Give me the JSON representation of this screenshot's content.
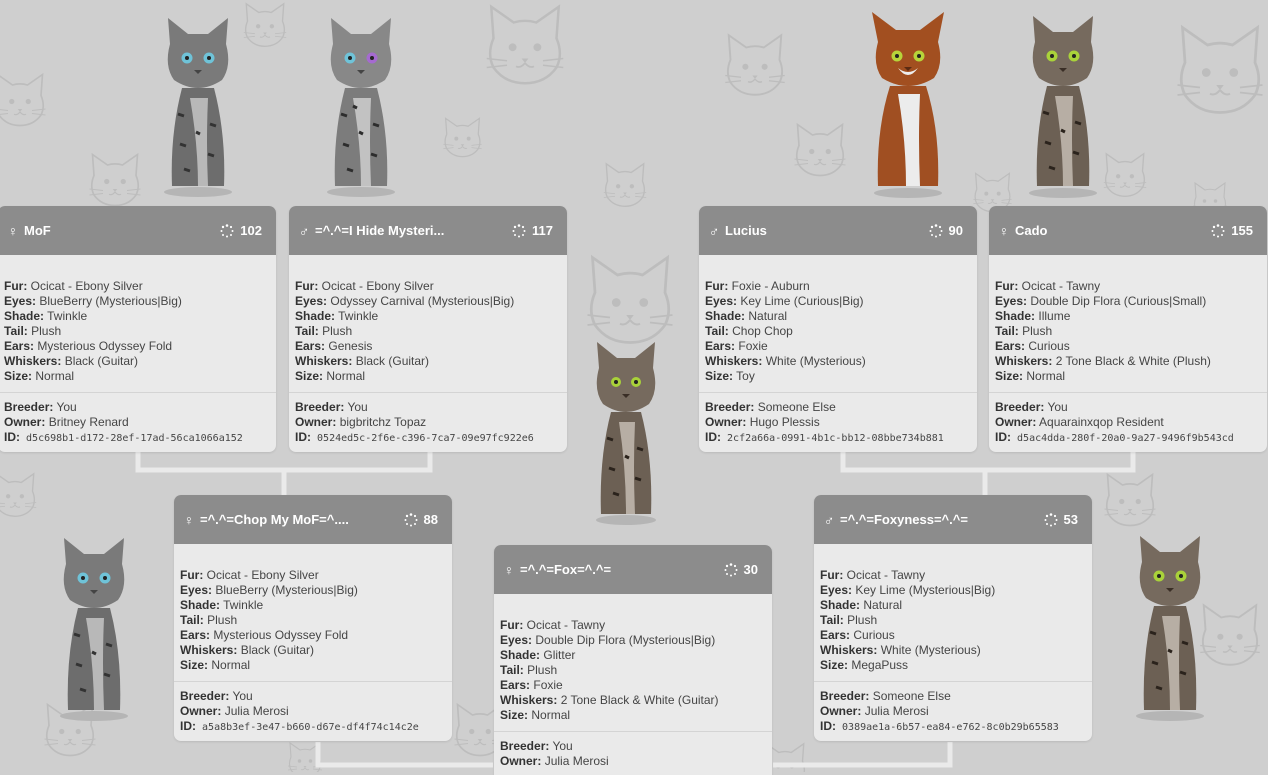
{
  "labels": {
    "fur": "Fur:",
    "eyes": "Eyes:",
    "shade": "Shade:",
    "tail": "Tail:",
    "ears": "Ears:",
    "whiskers": "Whiskers:",
    "size": "Size:",
    "breeder": "Breeder:",
    "owner": "Owner:",
    "id": "ID:"
  },
  "symbols": {
    "female": "♀",
    "male": "♂"
  },
  "colors": {
    "header": "#8c8c8c",
    "card_body": "#eaeaea",
    "background": "#cfcfcf"
  },
  "cats": {
    "mof": {
      "sex": "female",
      "name": "MoF",
      "score": "102",
      "fur": "Ocicat - Ebony Silver",
      "eyes": "BlueBerry (Mysterious|Big)",
      "shade": "Twinkle",
      "tail": "Plush",
      "ears": "Mysterious Odyssey Fold",
      "whiskers": "Black (Guitar)",
      "size": "Normal",
      "breeder": "You",
      "owner": "Britney Renard",
      "id": "d5c698b1-d172-28ef-17ad-56ca1066a152",
      "icon": "cat-gray-tabby"
    },
    "ihide": {
      "sex": "male",
      "name": "=^.^=I Hide Mysteri...",
      "score": "117",
      "fur": "Ocicat - Ebony Silver",
      "eyes": "Odyssey Carnival (Mysterious|Big)",
      "shade": "Twinkle",
      "tail": "Plush",
      "ears": "Genesis",
      "whiskers": "Black (Guitar)",
      "size": "Normal",
      "breeder": "You",
      "owner": "bigbritchz Topaz",
      "id": "0524ed5c-2f6e-c396-7ca7-09e97fc922e6",
      "icon": "cat-gray-spotted"
    },
    "lucius": {
      "sex": "male",
      "name": "Lucius",
      "score": "90",
      "fur": "Foxie - Auburn",
      "eyes": "Key Lime (Curious|Big)",
      "shade": "Natural",
      "tail": "Chop Chop",
      "ears": "Foxie",
      "whiskers": "White (Mysterious)",
      "size": "Toy",
      "breeder": "Someone Else",
      "owner": "Hugo Plessis",
      "id": "2cf2a66a-0991-4b1c-bb12-08bbe734b881",
      "icon": "cat-auburn"
    },
    "cado": {
      "sex": "female",
      "name": "Cado",
      "score": "155",
      "fur": "Ocicat - Tawny",
      "eyes": "Double Dip Flora (Curious|Small)",
      "shade": "Illume",
      "tail": "Plush",
      "ears": "Curious",
      "whiskers": "2 Tone Black & White (Plush)",
      "size": "Normal",
      "breeder": "You",
      "owner": "Aquarainxqop Resident",
      "id": "d5ac4dda-280f-20a0-9a27-9496f9b543cd",
      "icon": "cat-tawny-spotted"
    },
    "chop": {
      "sex": "female",
      "name": "=^.^=Chop My MoF=^....",
      "score": "88",
      "fur": "Ocicat - Ebony Silver",
      "eyes": "BlueBerry (Mysterious|Big)",
      "shade": "Twinkle",
      "tail": "Plush",
      "ears": "Mysterious Odyssey Fold",
      "whiskers": "Black (Guitar)",
      "size": "Normal",
      "breeder": "You",
      "owner": "Julia Merosi",
      "id": "a5a8b3ef-3e47-b660-d67e-df4f74c14c2e",
      "icon": "cat-gray-tabby"
    },
    "fox": {
      "sex": "female",
      "name": "=^.^=Fox=^.^=",
      "score": "30",
      "fur": "Ocicat - Tawny",
      "eyes": "Double Dip Flora (Mysterious|Big)",
      "shade": "Glitter",
      "tail": "Plush",
      "ears": "Foxie",
      "whiskers": "2 Tone Black & White (Guitar)",
      "size": "Normal",
      "breeder": "You",
      "owner": "Julia Merosi",
      "id": "",
      "icon": "cat-tawny-spotted"
    },
    "foxyness": {
      "sex": "male",
      "name": "=^.^=Foxyness=^.^=",
      "score": "53",
      "fur": "Ocicat - Tawny",
      "eyes": "Key Lime (Mysterious|Big)",
      "shade": "Natural",
      "tail": "Plush",
      "ears": "Curious",
      "whiskers": "White (Mysterious)",
      "size": "MegaPuss",
      "breeder": "Someone Else",
      "owner": "Julia Merosi",
      "id": "0389ae1a-6b57-ea84-e762-8c0b29b65583",
      "icon": "cat-tawny-spotted"
    }
  }
}
